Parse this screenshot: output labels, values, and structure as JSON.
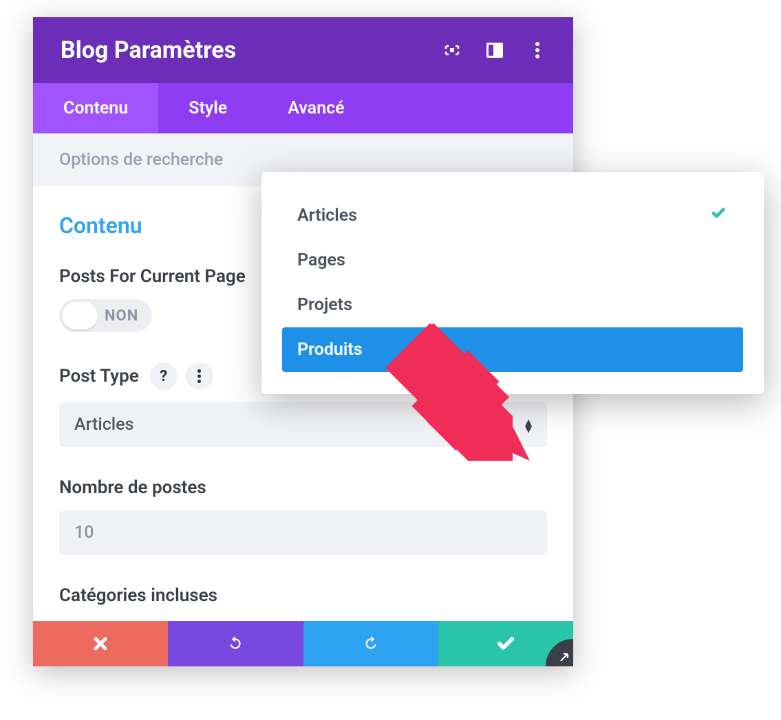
{
  "header": {
    "title": "Blog Paramètres"
  },
  "tabs": {
    "content": "Contenu",
    "style": "Style",
    "advanced": "Avancé"
  },
  "search": {
    "placeholder": "Options de recherche"
  },
  "section": {
    "title": "Contenu"
  },
  "fields": {
    "postsForCurrentPage": {
      "label": "Posts For Current Page",
      "toggle": "NON"
    },
    "postType": {
      "label": "Post Type",
      "value": "Articles"
    },
    "numberOfPosts": {
      "label": "Nombre de postes",
      "value": "10"
    },
    "includedCategories": {
      "label": "Catégories incluses"
    }
  },
  "popover": {
    "items": [
      {
        "label": "Articles",
        "checked": true
      },
      {
        "label": "Pages",
        "checked": false
      },
      {
        "label": "Projets",
        "checked": false
      },
      {
        "label": "Produits",
        "checked": false,
        "highlight": true
      }
    ]
  }
}
